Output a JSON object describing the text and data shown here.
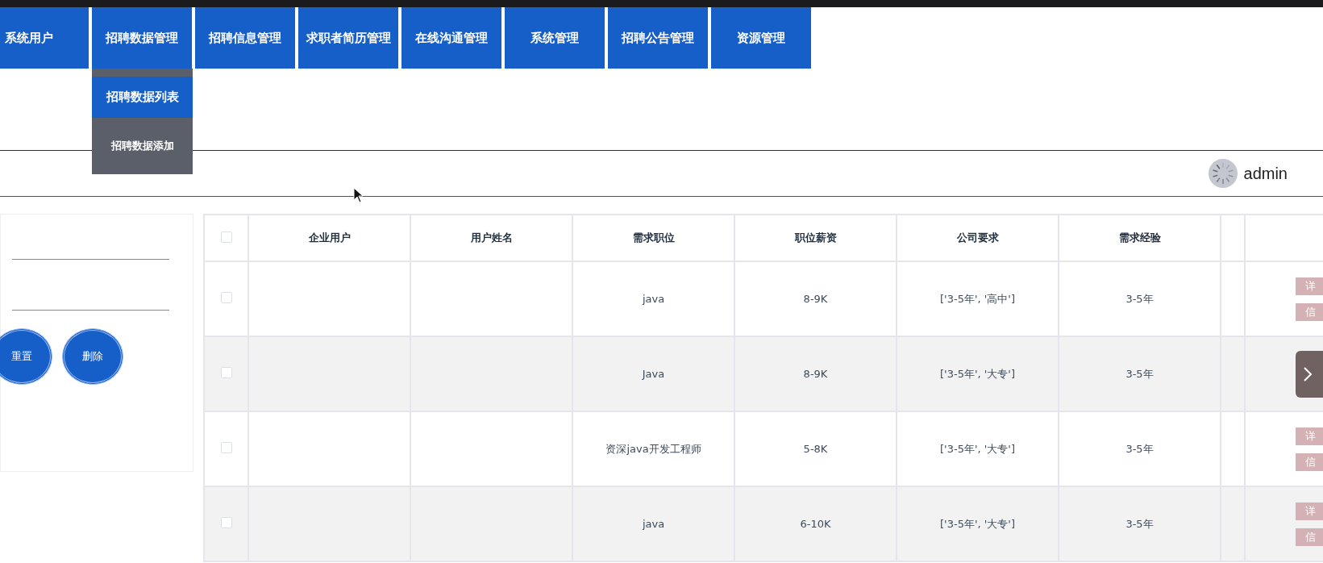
{
  "nav": [
    {
      "label": "系统用户",
      "expanded": false
    },
    {
      "label": "招聘数据管理",
      "expanded": true,
      "children": [
        {
          "label": "招聘数据列表",
          "selected": true
        },
        {
          "label": "招聘数据添加",
          "selected": false
        }
      ]
    },
    {
      "label": "招聘信息管理",
      "expanded": false
    },
    {
      "label": "求职者简历管理",
      "expanded": false
    },
    {
      "label": "在线沟通管理",
      "expanded": false
    },
    {
      "label": "系统管理",
      "expanded": false
    },
    {
      "label": "招聘公告管理",
      "expanded": false
    },
    {
      "label": "资源管理",
      "expanded": false
    }
  ],
  "user": {
    "name": "admin"
  },
  "buttons": [
    {
      "label": "重置"
    },
    {
      "label": "删除"
    }
  ],
  "table": {
    "header_checked": false,
    "columns": [
      "企业用户",
      "用户姓名",
      "需求职位",
      "职位薪资",
      "公司要求",
      "需求经验"
    ],
    "rows": [
      {
        "checked": false,
        "cells": [
          null,
          null,
          "java",
          "8-9K",
          "['3-5年', '高中']",
          "3-5年"
        ],
        "actions": [
          "详",
          "信"
        ]
      },
      {
        "checked": false,
        "cells": [
          null,
          null,
          "Java",
          "8-9K",
          "['3-5年', '大专']",
          "3-5年"
        ]
      },
      {
        "checked": false,
        "cells": [
          null,
          null,
          "资深java开发工程师",
          "5-8K",
          "['3-5年', '大专']",
          "3-5年"
        ],
        "actions": [
          "详",
          "信"
        ]
      },
      {
        "checked": false,
        "cells": [
          null,
          null,
          "java",
          "6-10K",
          "['3-5年', '大专']",
          "3-5年"
        ],
        "actions": [
          "详",
          "信"
        ]
      }
    ]
  }
}
